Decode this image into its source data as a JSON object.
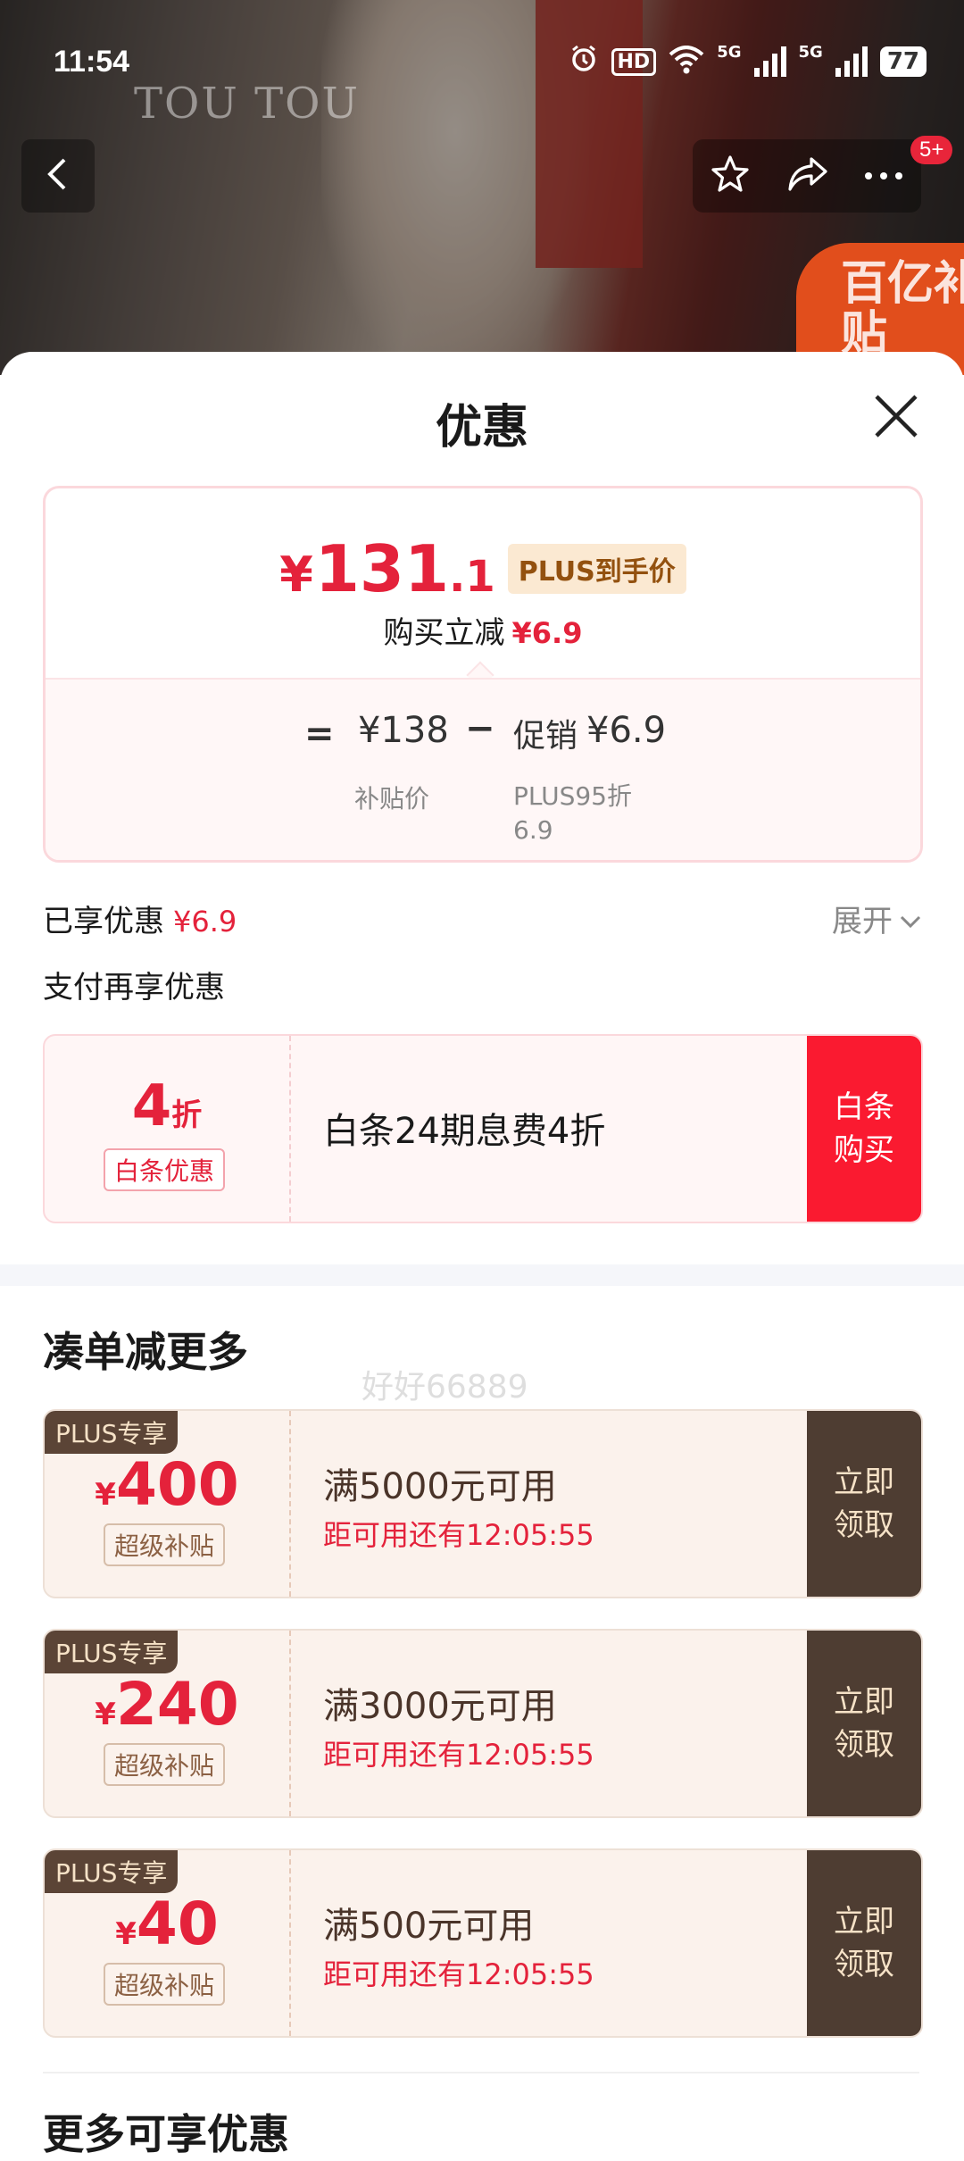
{
  "status_bar": {
    "time": "11:54",
    "hd_label": "HD",
    "net1": "5G",
    "net2": "5G",
    "battery": "77"
  },
  "hero": {
    "brand_text": "TOU TOU",
    "promo_text": "百亿补贴",
    "more_badge": "5+"
  },
  "sheet": {
    "title": "优惠"
  },
  "price_card": {
    "currency": "¥",
    "price_int": "131",
    "price_dec": ".1",
    "price_tag": "PLUS到手价",
    "reduce_label": "购买立减",
    "reduce_value": "¥6.9",
    "equals": "=",
    "subsidy_price": "¥138",
    "minus": "−",
    "promo_label": "促销",
    "promo_value": "¥6.9",
    "subsidy_label": "补贴价",
    "plus95_label": "PLUS95折",
    "plus95_value": "6.9"
  },
  "enjoyed": {
    "label": "已享优惠",
    "value": "¥6.9",
    "expand_label": "展开"
  },
  "pay_more": {
    "label": "支付再享优惠",
    "baitiao": {
      "discount_num": "4",
      "discount_unit": "折",
      "tag": "白条优惠",
      "desc": "白条24期息费4折",
      "button": "白条\n购买"
    }
  },
  "bundle": {
    "title": "凑单减更多",
    "coupons": [
      {
        "badge": "PLUS专享",
        "currency": "¥",
        "amount": "400",
        "tag": "超级补贴",
        "condition": "满5000元可用",
        "timer": "距可用还有12:05:55",
        "button": "立即\n领取"
      },
      {
        "badge": "PLUS专享",
        "currency": "¥",
        "amount": "240",
        "tag": "超级补贴",
        "condition": "满3000元可用",
        "timer": "距可用还有12:05:55",
        "button": "立即\n领取"
      },
      {
        "badge": "PLUS专享",
        "currency": "¥",
        "amount": "40",
        "tag": "超级补贴",
        "condition": "满500元可用",
        "timer": "距可用还有12:05:55",
        "button": "立即\n领取"
      }
    ]
  },
  "more": {
    "title": "更多可享优惠"
  },
  "watermark": "好好66889",
  "colors": {
    "accent_red": "#e4223b",
    "baitiao_button": "#fa1a30",
    "plus_dark": "#4e3d32"
  },
  "icons": [
    "back-icon",
    "star-icon",
    "share-icon",
    "more-icon",
    "close-icon",
    "chevron-down-icon",
    "alarm-icon",
    "wifi-icon",
    "signal-icon"
  ]
}
